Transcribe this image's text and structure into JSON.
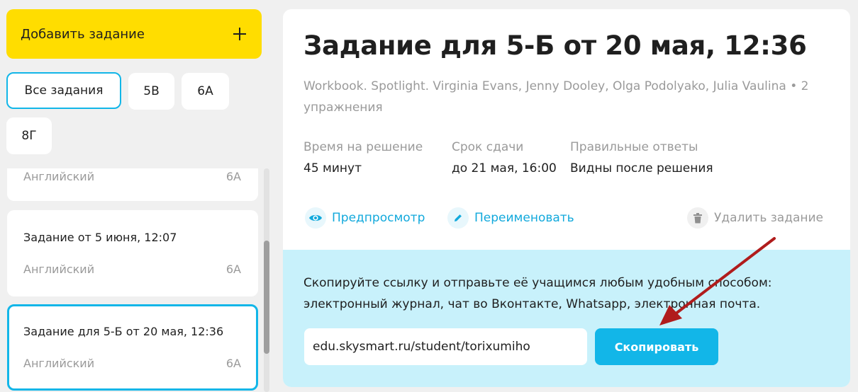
{
  "sidebar": {
    "add_task_label": "Добавить задание",
    "filters": [
      "Все задания",
      "5В",
      "6А",
      "8Г"
    ],
    "tasks": [
      {
        "title": "",
        "subject": "Английский",
        "class": "6А"
      },
      {
        "title": "Задание от 5 июня, 12:07",
        "subject": "Английский",
        "class": "6А"
      },
      {
        "title": "Задание для 5-Б от 20 мая, 12:36",
        "subject": "Английский",
        "class": "6А"
      }
    ]
  },
  "main": {
    "title": "Задание для 5-Б от 20 мая, 12:36",
    "book_line": "Workbook. Spotlight. Virginia Evans, Jenny Dooley, Olga Podolyako, Julia Vaulina • 2 упражнения",
    "meta": [
      {
        "label": "Время на решение",
        "value": "45 минут"
      },
      {
        "label": "Срок сдачи",
        "value": "до 21 мая, 16:00"
      },
      {
        "label": "Правильные ответы",
        "value": "Видны после решения"
      }
    ],
    "actions": {
      "preview": "Предпросмотр",
      "rename": "Переименовать",
      "delete": "Удалить задание"
    },
    "share": {
      "text": "Скопируйте ссылку и отправьте её учащимся любым удобным способом: электронный журнал, чат во Вконтакте, Whatsapp, электронная почта.",
      "link_value": "edu.skysmart.ru/student/torixumiho",
      "copy_label": "Скопировать"
    }
  },
  "colors": {
    "accent_yellow": "#ffdd00",
    "accent_blue": "#12b6e8",
    "share_bg": "#c8f1fb",
    "annotation_arrow": "#b01c1c"
  }
}
